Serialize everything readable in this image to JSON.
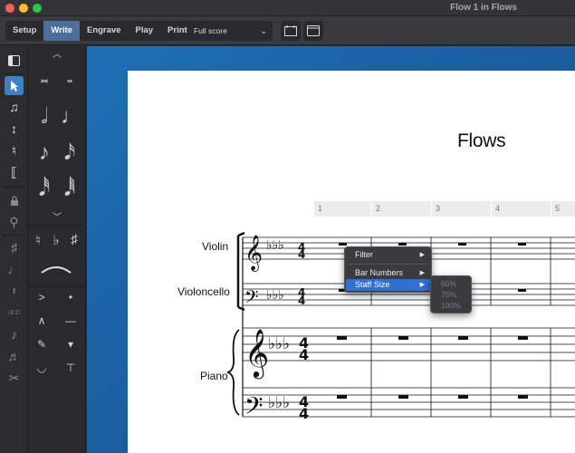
{
  "window": {
    "title": "Flow 1 in Flows"
  },
  "toolbar": {
    "modes": [
      "Setup",
      "Write",
      "Engrave",
      "Play",
      "Print"
    ],
    "active_mode": "Write",
    "layout_select": "Full score"
  },
  "icons": {
    "close": "close-icon",
    "minimize": "minimize-icon",
    "maximize": "maximize-icon",
    "panel_left": "panel-left-icon",
    "select": "select-arrow-icon",
    "note_input": "note-input-icon",
    "insert": "insert-icon",
    "chord": "chord-icon",
    "force_duration": "force-duration-icon",
    "lock": "lock-icon",
    "grace": "grace-note-icon",
    "accidental": "accidental-icon",
    "dot": "dotted-note-icon",
    "rest": "rest-icon",
    "tuplet": "tuplet-icon",
    "slur": "slur-icon",
    "tie": "tie-icon",
    "scissors": "scissors-icon"
  },
  "left_tools": {
    "tuplet_label": "⁝3:2⁝"
  },
  "palette": {
    "accidentals": [
      "♮",
      "♭",
      "♯"
    ]
  },
  "score": {
    "title": "Flows",
    "bar_numbers": [
      "1",
      "2",
      "3",
      "4",
      "5"
    ],
    "instruments": [
      "Violin",
      "Violoncello",
      "Piano"
    ]
  },
  "context_menu": {
    "items": [
      "Filter",
      "Bar Numbers",
      "Staff Size"
    ],
    "highlighted": "Staff Size",
    "submenu": [
      "60%",
      "75%",
      "100%"
    ]
  },
  "colors": {
    "accent": "#4a6f98",
    "menu_highlight": "#2f6fd6",
    "canvas_blue": "#1e6fb5"
  }
}
